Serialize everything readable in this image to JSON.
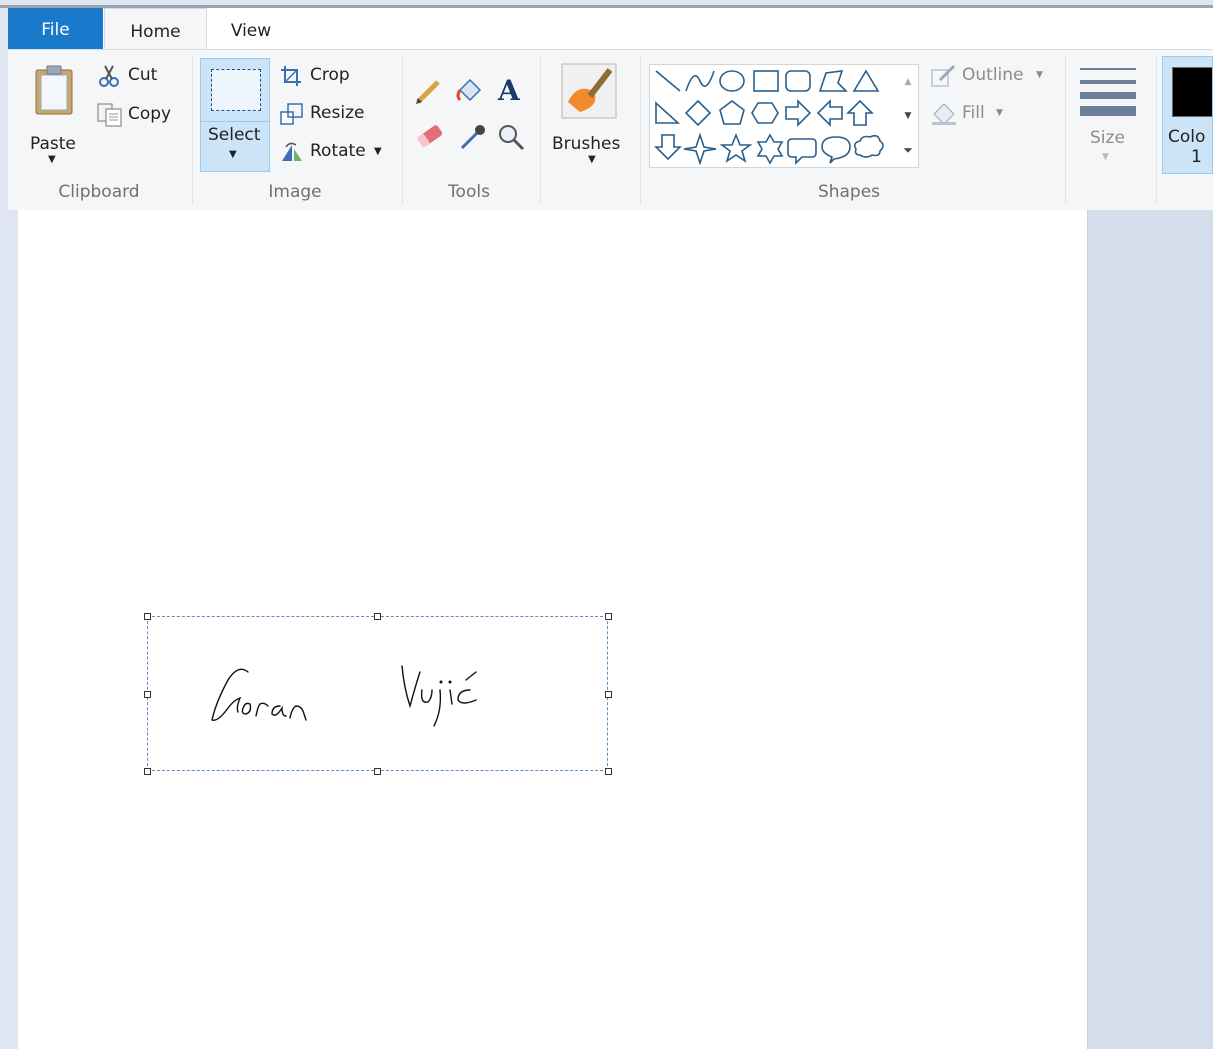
{
  "tabs": {
    "file": "File",
    "home": "Home",
    "view": "View"
  },
  "clipboard": {
    "paste": "Paste",
    "cut": "Cut",
    "copy": "Copy",
    "group": "Clipboard"
  },
  "image": {
    "select": "Select",
    "crop": "Crop",
    "resize": "Resize",
    "rotate": "Rotate",
    "group": "Image"
  },
  "tools": {
    "group": "Tools"
  },
  "brushes": {
    "label": "Brushes"
  },
  "shapes": {
    "group": "Shapes",
    "outline": "Outline",
    "fill": "Fill"
  },
  "size": {
    "label": "Size"
  },
  "color": {
    "label": "Colo",
    "number": "1",
    "swatch": "#000000"
  },
  "signature": {
    "text": "Goran Vujić"
  },
  "colors": {
    "accent": "#1979ca",
    "shape_stroke": "#2a5f8a"
  }
}
